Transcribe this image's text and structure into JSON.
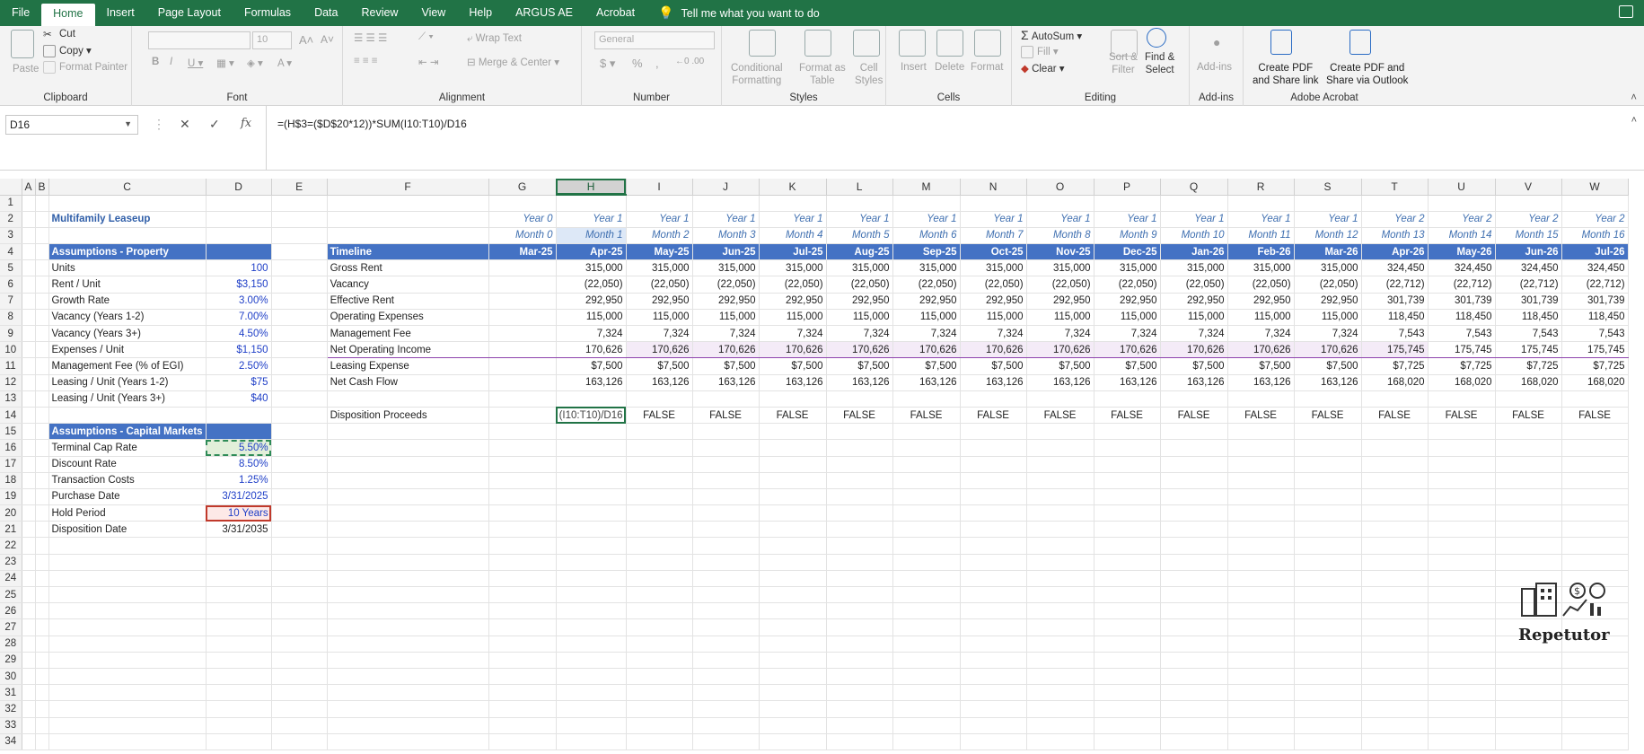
{
  "menu": {
    "tabs": [
      "File",
      "Home",
      "Insert",
      "Page Layout",
      "Formulas",
      "Data",
      "Review",
      "View",
      "Help",
      "ARGUS AE",
      "Acrobat"
    ],
    "active": "Home",
    "tell_me": "Tell me what you want to do"
  },
  "ribbon": {
    "clipboard": {
      "label": "Clipboard",
      "paste": "Paste",
      "cut": "Cut",
      "copy": "Copy",
      "format_painter": "Format Painter"
    },
    "font": {
      "label": "Font",
      "size": "10"
    },
    "alignment": {
      "label": "Alignment",
      "wrap": "Wrap Text",
      "merge": "Merge & Center"
    },
    "number": {
      "label": "Number",
      "format": "General",
      "currency": "$",
      "percent": "%",
      "comma": ","
    },
    "styles": {
      "label": "Styles",
      "conditional": "Conditional\nFormatting",
      "format_table": "Format as\nTable",
      "cell_styles": "Cell\nStyles"
    },
    "cells": {
      "label": "Cells",
      "insert": "Insert",
      "delete": "Delete",
      "format": "Format"
    },
    "editing": {
      "label": "Editing",
      "autosum": "AutoSum",
      "fill": "Fill",
      "clear": "Clear",
      "sort": "Sort &\nFilter",
      "find": "Find &\nSelect"
    },
    "addins": {
      "label": "Add-ins",
      "addins": "Add-ins"
    },
    "acrobat": {
      "label": "Adobe Acrobat",
      "pdf_link": "Create PDF\nand Share link",
      "pdf_outlook": "Create PDF and\nShare via Outlook"
    }
  },
  "formula_bar": {
    "name_box": "D16",
    "formula": "=(H$3=($D$20*12))*SUM(I10:T10)/D16"
  },
  "columns": [
    "A",
    "B",
    "C",
    "D",
    "E",
    "F",
    "G",
    "H",
    "I",
    "J",
    "K",
    "L",
    "M",
    "N",
    "O",
    "P",
    "Q",
    "R",
    "S",
    "T",
    "U",
    "V",
    "W"
  ],
  "rows": {
    "r2": {
      "C": "Multifamily Leaseup",
      "G": "Year 0",
      "H": "Year 1",
      "I": "Year 1",
      "J": "Year 1",
      "K": "Year 1",
      "L": "Year 1",
      "M": "Year 1",
      "N": "Year 1",
      "O": "Year 1",
      "P": "Year 1",
      "Q": "Year 1",
      "R": "Year 1",
      "S": "Year 1",
      "T": "Year 2",
      "U": "Year 2",
      "V": "Year 2",
      "W": "Year 2"
    },
    "r3": {
      "G": "Month 0",
      "H": "Month 1",
      "I": "Month 2",
      "J": "Month 3",
      "K": "Month 4",
      "L": "Month 5",
      "M": "Month 6",
      "N": "Month 7",
      "O": "Month 8",
      "P": "Month 9",
      "Q": "Month 10",
      "R": "Month 11",
      "S": "Month 12",
      "T": "Month 13",
      "U": "Month 14",
      "V": "Month 15",
      "W": "Month 16"
    },
    "r4": {
      "C": "Assumptions - Property",
      "F": "Timeline",
      "G": "Mar-25",
      "H": "Apr-25",
      "I": "May-25",
      "J": "Jun-25",
      "K": "Jul-25",
      "L": "Aug-25",
      "M": "Sep-25",
      "N": "Oct-25",
      "O": "Nov-25",
      "P": "Dec-25",
      "Q": "Jan-26",
      "R": "Feb-26",
      "S": "Mar-26",
      "T": "Apr-26",
      "U": "May-26",
      "V": "Jun-26",
      "W": "Jul-26"
    },
    "r5": {
      "C": "Units",
      "D": "100",
      "F": "Gross Rent",
      "H": "315,000",
      "I": "315,000",
      "J": "315,000",
      "K": "315,000",
      "L": "315,000",
      "M": "315,000",
      "N": "315,000",
      "O": "315,000",
      "P": "315,000",
      "Q": "315,000",
      "R": "315,000",
      "S": "315,000",
      "T": "324,450",
      "U": "324,450",
      "V": "324,450",
      "W": "324,450"
    },
    "r6": {
      "C": "Rent / Unit",
      "D": "$3,150",
      "F": "Vacancy",
      "H": "(22,050)",
      "I": "(22,050)",
      "J": "(22,050)",
      "K": "(22,050)",
      "L": "(22,050)",
      "M": "(22,050)",
      "N": "(22,050)",
      "O": "(22,050)",
      "P": "(22,050)",
      "Q": "(22,050)",
      "R": "(22,050)",
      "S": "(22,050)",
      "T": "(22,712)",
      "U": "(22,712)",
      "V": "(22,712)",
      "W": "(22,712)"
    },
    "r7": {
      "C": "Growth Rate",
      "D": "3.00%",
      "F": "Effective Rent",
      "H": "292,950",
      "I": "292,950",
      "J": "292,950",
      "K": "292,950",
      "L": "292,950",
      "M": "292,950",
      "N": "292,950",
      "O": "292,950",
      "P": "292,950",
      "Q": "292,950",
      "R": "292,950",
      "S": "292,950",
      "T": "301,739",
      "U": "301,739",
      "V": "301,739",
      "W": "301,739"
    },
    "r8": {
      "C": "Vacancy (Years 1-2)",
      "D": "7.00%",
      "F": "Operating Expenses",
      "H": "115,000",
      "I": "115,000",
      "J": "115,000",
      "K": "115,000",
      "L": "115,000",
      "M": "115,000",
      "N": "115,000",
      "O": "115,000",
      "P": "115,000",
      "Q": "115,000",
      "R": "115,000",
      "S": "115,000",
      "T": "118,450",
      "U": "118,450",
      "V": "118,450",
      "W": "118,450"
    },
    "r9": {
      "C": "Vacancy (Years 3+)",
      "D": "4.50%",
      "F": "Management Fee",
      "H": "7,324",
      "I": "7,324",
      "J": "7,324",
      "K": "7,324",
      "L": "7,324",
      "M": "7,324",
      "N": "7,324",
      "O": "7,324",
      "P": "7,324",
      "Q": "7,324",
      "R": "7,324",
      "S": "7,324",
      "T": "7,543",
      "U": "7,543",
      "V": "7,543",
      "W": "7,543"
    },
    "r10": {
      "C": "Expenses / Unit",
      "D": "$1,150",
      "F": "Net Operating Income",
      "H": "170,626",
      "I": "170,626",
      "J": "170,626",
      "K": "170,626",
      "L": "170,626",
      "M": "170,626",
      "N": "170,626",
      "O": "170,626",
      "P": "170,626",
      "Q": "170,626",
      "R": "170,626",
      "S": "170,626",
      "T": "175,745",
      "U": "175,745",
      "V": "175,745",
      "W": "175,745"
    },
    "r11": {
      "C": "Management Fee (% of EGI)",
      "D": "2.50%",
      "F": "Leasing Expense",
      "H": "$7,500",
      "I": "$7,500",
      "J": "$7,500",
      "K": "$7,500",
      "L": "$7,500",
      "M": "$7,500",
      "N": "$7,500",
      "O": "$7,500",
      "P": "$7,500",
      "Q": "$7,500",
      "R": "$7,500",
      "S": "$7,500",
      "T": "$7,725",
      "U": "$7,725",
      "V": "$7,725",
      "W": "$7,725"
    },
    "r12": {
      "C": "Leasing / Unit (Years 1-2)",
      "D": "$75",
      "F": "Net Cash Flow",
      "H": "163,126",
      "I": "163,126",
      "J": "163,126",
      "K": "163,126",
      "L": "163,126",
      "M": "163,126",
      "N": "163,126",
      "O": "163,126",
      "P": "163,126",
      "Q": "163,126",
      "R": "163,126",
      "S": "163,126",
      "T": "168,020",
      "U": "168,020",
      "V": "168,020",
      "W": "168,020"
    },
    "r13": {
      "C": "Leasing / Unit (Years 3+)",
      "D": "$40"
    },
    "r14": {
      "F": "Disposition Proceeds",
      "H": "(I10:T10)/D16",
      "I": "FALSE",
      "J": "FALSE",
      "K": "FALSE",
      "L": "FALSE",
      "M": "FALSE",
      "N": "FALSE",
      "O": "FALSE",
      "P": "FALSE",
      "Q": "FALSE",
      "R": "FALSE",
      "S": "FALSE",
      "T": "FALSE",
      "U": "FALSE",
      "V": "FALSE",
      "W": "FALSE"
    },
    "r15": {
      "C": "Assumptions - Capital Markets"
    },
    "r16": {
      "C": "Terminal Cap Rate",
      "D": "5.50%"
    },
    "r17": {
      "C": "Discount Rate",
      "D": "8.50%"
    },
    "r18": {
      "C": "Transaction Costs",
      "D": "1.25%"
    },
    "r19": {
      "C": "Purchase Date",
      "D": "3/31/2025"
    },
    "r20": {
      "C": "Hold Period",
      "D": "10 Years"
    },
    "r21": {
      "C": "Disposition Date",
      "D": "3/31/2035"
    }
  },
  "logo_text": "Repetutor"
}
